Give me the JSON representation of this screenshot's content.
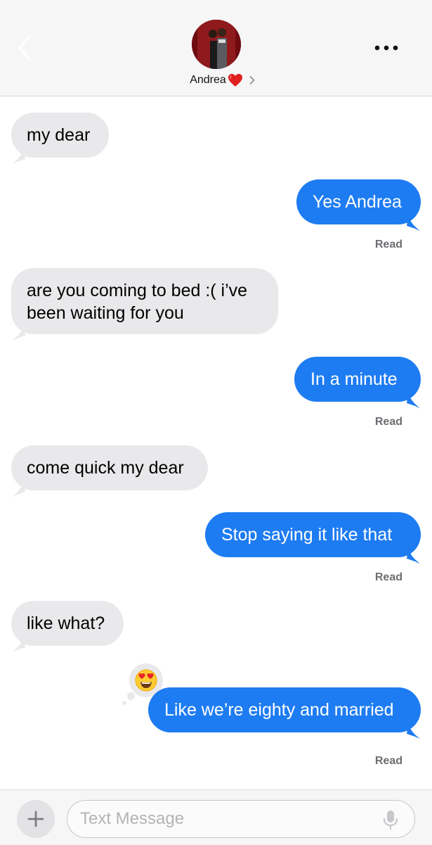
{
  "header": {
    "contact_name": "Andrea",
    "contact_emoji": "❤️",
    "back_icon": "chevron-left-icon",
    "more_icon": "ellipsis-icon"
  },
  "messages": [
    {
      "direction": "incoming",
      "text": "my dear"
    },
    {
      "direction": "outgoing",
      "text": "Yes Andrea",
      "status": "Read"
    },
    {
      "direction": "incoming",
      "text_lines": [
        "are you coming to bed :( i’ve",
        "been waiting for you"
      ]
    },
    {
      "direction": "outgoing",
      "text": "In a minute",
      "status": "Read"
    },
    {
      "direction": "incoming",
      "text": "come quick my dear"
    },
    {
      "direction": "outgoing",
      "text": "Stop saying it like that",
      "status": "Read"
    },
    {
      "direction": "incoming",
      "text": "like what?"
    },
    {
      "direction": "outgoing",
      "text": "Like we’re eighty and married",
      "status": "Read",
      "reaction": "heart-eyes-emoji"
    }
  ],
  "composer": {
    "placeholder": "Text Message",
    "value": ""
  },
  "colors": {
    "outgoing_bubble": "#1e7cf2",
    "incoming_bubble": "#e9e9eb",
    "header_bg": "#f6f6f6"
  }
}
